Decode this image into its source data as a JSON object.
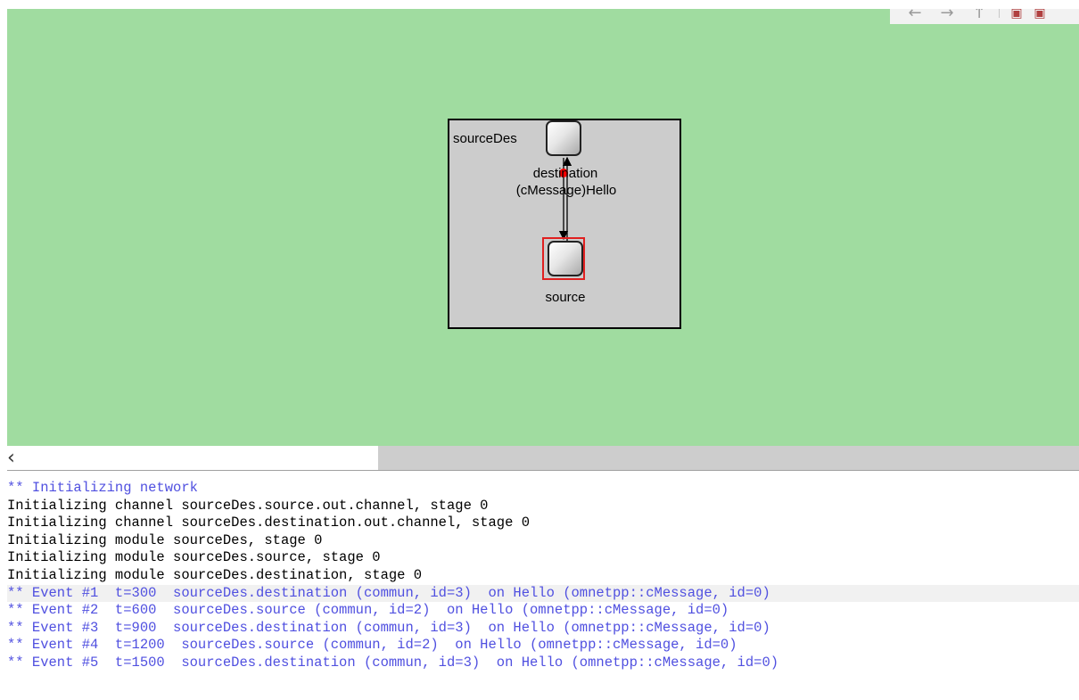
{
  "toolbar": {
    "back_icon": "arrow-left-icon",
    "forward_icon": "arrow-right-icon",
    "up_icon": "arrow-up-icon",
    "zoom_icon": "zoom-icon"
  },
  "network": {
    "name": "sourceDes",
    "modules": {
      "destination": {
        "label": "destination"
      },
      "source": {
        "label": "source"
      }
    },
    "message_label": "(cMessage)Hello",
    "colors": {
      "canvas_bg": "#a0dca0",
      "module_bg": "#cccccc",
      "selection": "#e02020",
      "message_dot": "#ff0000"
    }
  },
  "scrollbar": {
    "left_arrow": "‹"
  },
  "log": {
    "lines": [
      {
        "text": "** Initializing network",
        "kind": "event"
      },
      {
        "text": "Initializing channel sourceDes.source.out.channel, stage 0",
        "kind": "info"
      },
      {
        "text": "Initializing channel sourceDes.destination.out.channel, stage 0",
        "kind": "info"
      },
      {
        "text": "Initializing module sourceDes, stage 0",
        "kind": "info"
      },
      {
        "text": "Initializing module sourceDes.source, stage 0",
        "kind": "info"
      },
      {
        "text": "Initializing module sourceDes.destination, stage 0",
        "kind": "info"
      },
      {
        "text": "** Event #1  t=300  sourceDes.destination (commun, id=3)  on Hello (omnetpp::cMessage, id=0)",
        "kind": "event"
      },
      {
        "text": "** Event #2  t=600  sourceDes.source (commun, id=2)  on Hello (omnetpp::cMessage, id=0)",
        "kind": "event"
      },
      {
        "text": "** Event #3  t=900  sourceDes.destination (commun, id=3)  on Hello (omnetpp::cMessage, id=0)",
        "kind": "event"
      },
      {
        "text": "** Event #4  t=1200  sourceDes.source (commun, id=2)  on Hello (omnetpp::cMessage, id=0)",
        "kind": "event"
      },
      {
        "text": "** Event #5  t=1500  sourceDes.destination (commun, id=3)  on Hello (omnetpp::cMessage, id=0)",
        "kind": "event"
      }
    ]
  }
}
